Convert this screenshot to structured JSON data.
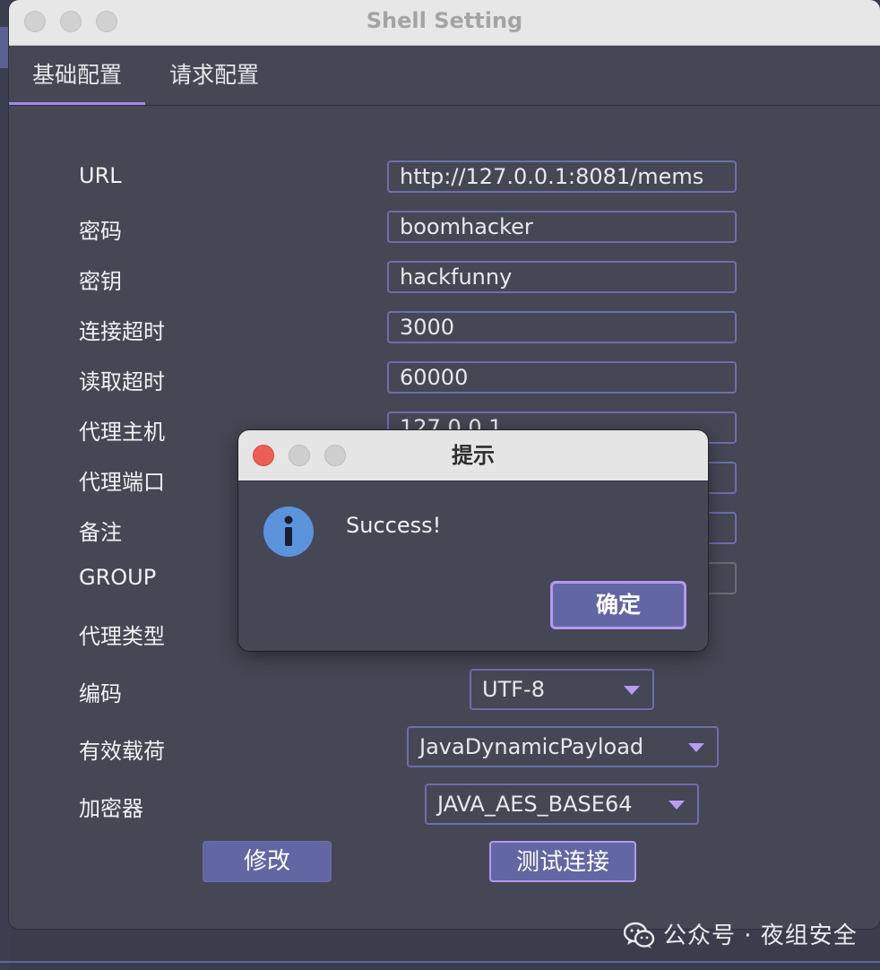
{
  "window": {
    "title": "Shell Setting"
  },
  "tabs": [
    {
      "label": "基础配置"
    },
    {
      "label": "请求配置"
    }
  ],
  "form": {
    "labels": {
      "url": "URL",
      "password": "密码",
      "key": "密钥",
      "connect_timeout": "连接超时",
      "read_timeout": "读取超时",
      "proxy_host": "代理主机",
      "proxy_port": "代理端口",
      "remark": "备注",
      "group": "GROUP",
      "proxy_type": "代理类型",
      "encoding": "编码",
      "payload": "有效载荷",
      "cryptor": "加密器"
    },
    "values": {
      "url": "http://127.0.0.1:8081/mems",
      "password": "boomhacker",
      "key": "hackfunny",
      "connect_timeout": "3000",
      "read_timeout": "60000",
      "proxy_host": "127.0.0.1",
      "encoding": "UTF-8",
      "payload": "JavaDynamicPayload",
      "cryptor": "JAVA_AES_BASE64"
    },
    "buttons": {
      "modify": "修改",
      "test_connection": "测试连接"
    }
  },
  "dialog": {
    "title": "提示",
    "message": "Success!",
    "ok_label": "确定",
    "icon": "info-icon"
  },
  "watermark": {
    "text": "公众号 · 夜组安全",
    "icon": "wechat-icon"
  },
  "colors": {
    "window_bg": "#454755",
    "accent_purple": "#a488e6",
    "field_border": "#6a70aa",
    "button_bg": "#6267a3",
    "close_red": "#ec5f57",
    "info_blue": "#5b93dd"
  }
}
